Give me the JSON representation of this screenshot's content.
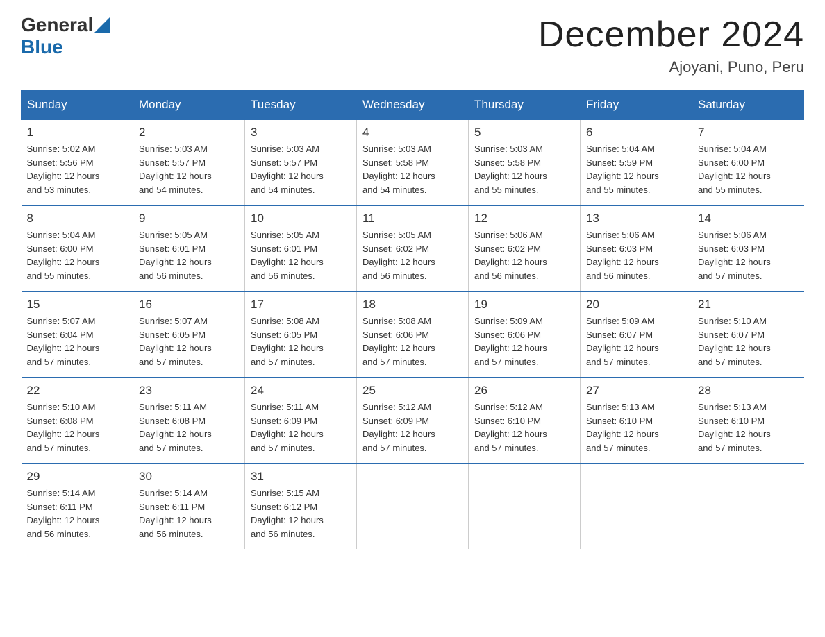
{
  "header": {
    "logo_general": "General",
    "logo_blue": "Blue",
    "title": "December 2024",
    "subtitle": "Ajoyani, Puno, Peru"
  },
  "days_of_week": [
    "Sunday",
    "Monday",
    "Tuesday",
    "Wednesday",
    "Thursday",
    "Friday",
    "Saturday"
  ],
  "weeks": [
    [
      {
        "day": "1",
        "info": "Sunrise: 5:02 AM\nSunset: 5:56 PM\nDaylight: 12 hours\nand 53 minutes."
      },
      {
        "day": "2",
        "info": "Sunrise: 5:03 AM\nSunset: 5:57 PM\nDaylight: 12 hours\nand 54 minutes."
      },
      {
        "day": "3",
        "info": "Sunrise: 5:03 AM\nSunset: 5:57 PM\nDaylight: 12 hours\nand 54 minutes."
      },
      {
        "day": "4",
        "info": "Sunrise: 5:03 AM\nSunset: 5:58 PM\nDaylight: 12 hours\nand 54 minutes."
      },
      {
        "day": "5",
        "info": "Sunrise: 5:03 AM\nSunset: 5:58 PM\nDaylight: 12 hours\nand 55 minutes."
      },
      {
        "day": "6",
        "info": "Sunrise: 5:04 AM\nSunset: 5:59 PM\nDaylight: 12 hours\nand 55 minutes."
      },
      {
        "day": "7",
        "info": "Sunrise: 5:04 AM\nSunset: 6:00 PM\nDaylight: 12 hours\nand 55 minutes."
      }
    ],
    [
      {
        "day": "8",
        "info": "Sunrise: 5:04 AM\nSunset: 6:00 PM\nDaylight: 12 hours\nand 55 minutes."
      },
      {
        "day": "9",
        "info": "Sunrise: 5:05 AM\nSunset: 6:01 PM\nDaylight: 12 hours\nand 56 minutes."
      },
      {
        "day": "10",
        "info": "Sunrise: 5:05 AM\nSunset: 6:01 PM\nDaylight: 12 hours\nand 56 minutes."
      },
      {
        "day": "11",
        "info": "Sunrise: 5:05 AM\nSunset: 6:02 PM\nDaylight: 12 hours\nand 56 minutes."
      },
      {
        "day": "12",
        "info": "Sunrise: 5:06 AM\nSunset: 6:02 PM\nDaylight: 12 hours\nand 56 minutes."
      },
      {
        "day": "13",
        "info": "Sunrise: 5:06 AM\nSunset: 6:03 PM\nDaylight: 12 hours\nand 56 minutes."
      },
      {
        "day": "14",
        "info": "Sunrise: 5:06 AM\nSunset: 6:03 PM\nDaylight: 12 hours\nand 57 minutes."
      }
    ],
    [
      {
        "day": "15",
        "info": "Sunrise: 5:07 AM\nSunset: 6:04 PM\nDaylight: 12 hours\nand 57 minutes."
      },
      {
        "day": "16",
        "info": "Sunrise: 5:07 AM\nSunset: 6:05 PM\nDaylight: 12 hours\nand 57 minutes."
      },
      {
        "day": "17",
        "info": "Sunrise: 5:08 AM\nSunset: 6:05 PM\nDaylight: 12 hours\nand 57 minutes."
      },
      {
        "day": "18",
        "info": "Sunrise: 5:08 AM\nSunset: 6:06 PM\nDaylight: 12 hours\nand 57 minutes."
      },
      {
        "day": "19",
        "info": "Sunrise: 5:09 AM\nSunset: 6:06 PM\nDaylight: 12 hours\nand 57 minutes."
      },
      {
        "day": "20",
        "info": "Sunrise: 5:09 AM\nSunset: 6:07 PM\nDaylight: 12 hours\nand 57 minutes."
      },
      {
        "day": "21",
        "info": "Sunrise: 5:10 AM\nSunset: 6:07 PM\nDaylight: 12 hours\nand 57 minutes."
      }
    ],
    [
      {
        "day": "22",
        "info": "Sunrise: 5:10 AM\nSunset: 6:08 PM\nDaylight: 12 hours\nand 57 minutes."
      },
      {
        "day": "23",
        "info": "Sunrise: 5:11 AM\nSunset: 6:08 PM\nDaylight: 12 hours\nand 57 minutes."
      },
      {
        "day": "24",
        "info": "Sunrise: 5:11 AM\nSunset: 6:09 PM\nDaylight: 12 hours\nand 57 minutes."
      },
      {
        "day": "25",
        "info": "Sunrise: 5:12 AM\nSunset: 6:09 PM\nDaylight: 12 hours\nand 57 minutes."
      },
      {
        "day": "26",
        "info": "Sunrise: 5:12 AM\nSunset: 6:10 PM\nDaylight: 12 hours\nand 57 minutes."
      },
      {
        "day": "27",
        "info": "Sunrise: 5:13 AM\nSunset: 6:10 PM\nDaylight: 12 hours\nand 57 minutes."
      },
      {
        "day": "28",
        "info": "Sunrise: 5:13 AM\nSunset: 6:10 PM\nDaylight: 12 hours\nand 57 minutes."
      }
    ],
    [
      {
        "day": "29",
        "info": "Sunrise: 5:14 AM\nSunset: 6:11 PM\nDaylight: 12 hours\nand 56 minutes."
      },
      {
        "day": "30",
        "info": "Sunrise: 5:14 AM\nSunset: 6:11 PM\nDaylight: 12 hours\nand 56 minutes."
      },
      {
        "day": "31",
        "info": "Sunrise: 5:15 AM\nSunset: 6:12 PM\nDaylight: 12 hours\nand 56 minutes."
      },
      {
        "day": "",
        "info": ""
      },
      {
        "day": "",
        "info": ""
      },
      {
        "day": "",
        "info": ""
      },
      {
        "day": "",
        "info": ""
      }
    ]
  ]
}
